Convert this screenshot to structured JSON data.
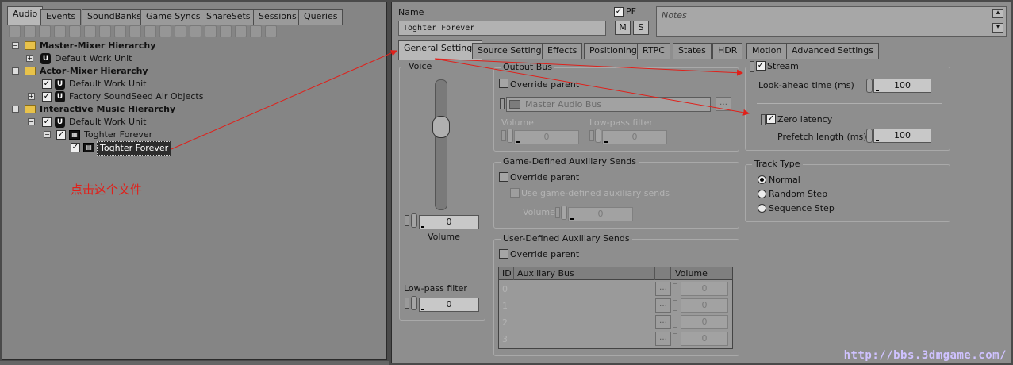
{
  "left": {
    "tabs": [
      "Audio",
      "Events",
      "SoundBanks",
      "Game Syncs",
      "ShareSets",
      "Sessions",
      "Queries"
    ],
    "tree": {
      "master_mixer": "Master-Mixer Hierarchy",
      "master_wu": "Default Work Unit",
      "actor_mixer": "Actor-Mixer Hierarchy",
      "actor_wu": "Default Work Unit",
      "factory": "Factory SoundSeed Air Objects",
      "interactive": "Interactive Music Hierarchy",
      "interactive_wu": "Default Work Unit",
      "playlist": "Toghter Forever",
      "segment": "Toghter Forever"
    },
    "annotation": "点击这个文件"
  },
  "right": {
    "name_label": "Name",
    "name_value": "Toghter Forever",
    "pf_label": "PF",
    "m_label": "M",
    "s_label": "S",
    "notes_placeholder": "Notes",
    "tabs": [
      "General Settings",
      "Source Settings",
      "Effects",
      "Positioning",
      "RTPC",
      "States",
      "HDR",
      "Motion",
      "Advanced Settings"
    ],
    "voice": {
      "title": "Voice",
      "volume_value": "0",
      "volume_label": "Volume",
      "lowpass_label": "Low-pass filter",
      "lowpass_value": "0"
    },
    "output_bus": {
      "title": "Output Bus",
      "override": "Override parent",
      "bus": "Master Audio Bus",
      "volume_label": "Volume",
      "volume_value": "0",
      "lpf_label": "Low-pass filter",
      "lpf_value": "0"
    },
    "game_aux": {
      "title": "Game-Defined Auxiliary Sends",
      "override": "Override parent",
      "use": "Use game-defined auxiliary sends",
      "volume_label": "Volume",
      "volume_value": "0"
    },
    "user_aux": {
      "title": "User-Defined Auxiliary Sends",
      "override": "Override parent",
      "col_id": "ID",
      "col_bus": "Auxiliary Bus",
      "col_volume": "Volume",
      "rows": [
        {
          "id": "0",
          "volume": "0"
        },
        {
          "id": "1",
          "volume": "0"
        },
        {
          "id": "2",
          "volume": "0"
        },
        {
          "id": "3",
          "volume": "0"
        }
      ]
    },
    "stream": {
      "label": "Stream",
      "lookahead_label": "Look-ahead time (ms)",
      "lookahead_value": "100",
      "zero_latency": "Zero latency",
      "prefetch_label": "Prefetch length (ms)",
      "prefetch_value": "100"
    },
    "track_type": {
      "title": "Track Type",
      "options": [
        "Normal",
        "Random Step",
        "Sequence Step"
      ],
      "selected": "Normal"
    }
  },
  "watermark": "http://bbs.3dmgame.com/",
  "colors": {
    "annotation": "#e0201a",
    "watermark": "#cfc2ff"
  }
}
